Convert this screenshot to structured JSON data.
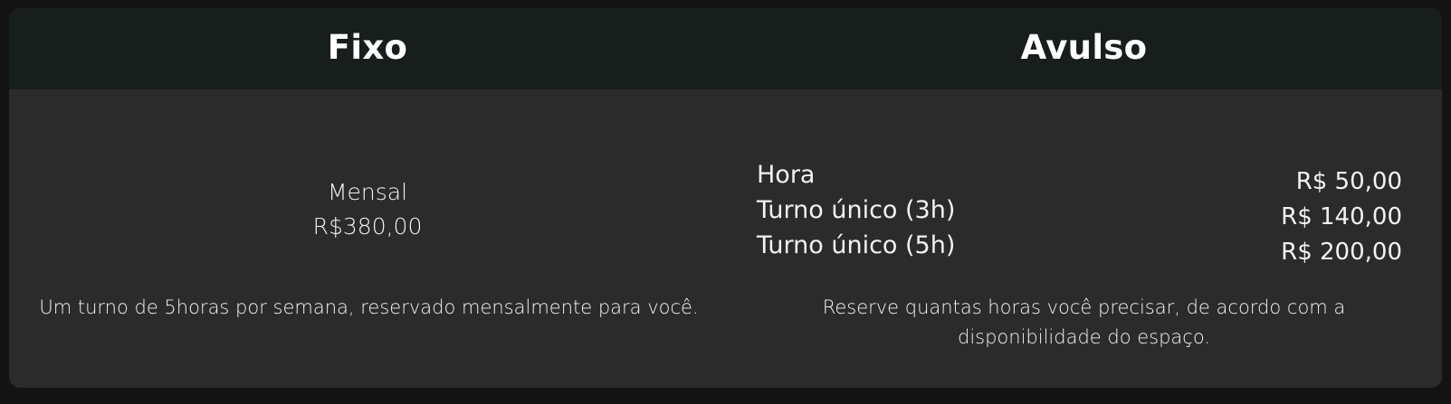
{
  "fixo": {
    "title": "Fixo",
    "period": "Mensal",
    "price": "R$380,00",
    "description": "Um turno de 5horas por semana, reservado mensalmente para você."
  },
  "avulso": {
    "title": "Avulso",
    "rows": [
      {
        "label": "Hora",
        "price": "R$ 50,00"
      },
      {
        "label": "Turno único (3h)",
        "price": "R$ 140,00"
      },
      {
        "label": "Turno único (5h)",
        "price": "R$ 200,00"
      }
    ],
    "description": "Reserve quantas horas você precisar, de acordo com a disponibilidade do espaço."
  },
  "colors": {
    "page_background": "#131313",
    "card_background": "#2b2b2b",
    "header_background": "#171e1b",
    "text": "#f2f2f2"
  }
}
